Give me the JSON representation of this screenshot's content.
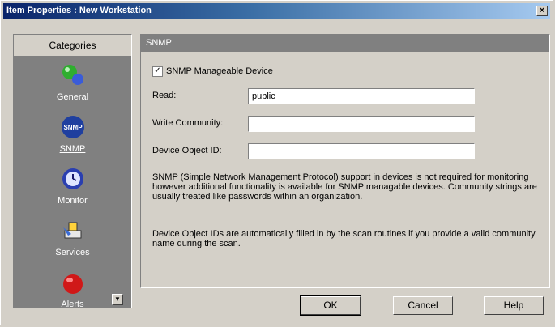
{
  "window": {
    "title": "Item Properties : New Workstation",
    "close_label": "×"
  },
  "sidebar": {
    "header": "Categories",
    "items": [
      {
        "label": "General",
        "icon": "general-icon"
      },
      {
        "label": "SNMP",
        "icon": "snmp-icon",
        "badge": "SNMP",
        "selected": true
      },
      {
        "label": "Monitor",
        "icon": "monitor-icon"
      },
      {
        "label": "Services",
        "icon": "services-icon"
      },
      {
        "label": "Alerts",
        "icon": "alerts-icon"
      }
    ],
    "scroll_label": "▼"
  },
  "panel": {
    "header": "SNMP",
    "manageable": {
      "label": "SNMP Manageable Device",
      "checked": true,
      "check_mark": "✓"
    },
    "read": {
      "label": "Read:",
      "value": "public"
    },
    "write": {
      "label": "Write Community:",
      "value": ""
    },
    "object_id": {
      "label": "Device Object ID:",
      "value": ""
    },
    "desc1": "SNMP (Simple Network Management Protocol) support in devices is not required for monitoring however additional functionality is available for SNMP managable devices. Community strings are usually treated like passwords within an organization.",
    "desc2": "Device Object IDs are automatically filled in by the scan routines if you provide a valid community name during the scan."
  },
  "buttons": {
    "ok": "OK",
    "cancel": "Cancel",
    "help": "Help"
  },
  "colors": {
    "title_start": "#0a246a",
    "title_end": "#a6caf0",
    "sidebar_bg": "#808080",
    "face": "#d4d0c8"
  }
}
